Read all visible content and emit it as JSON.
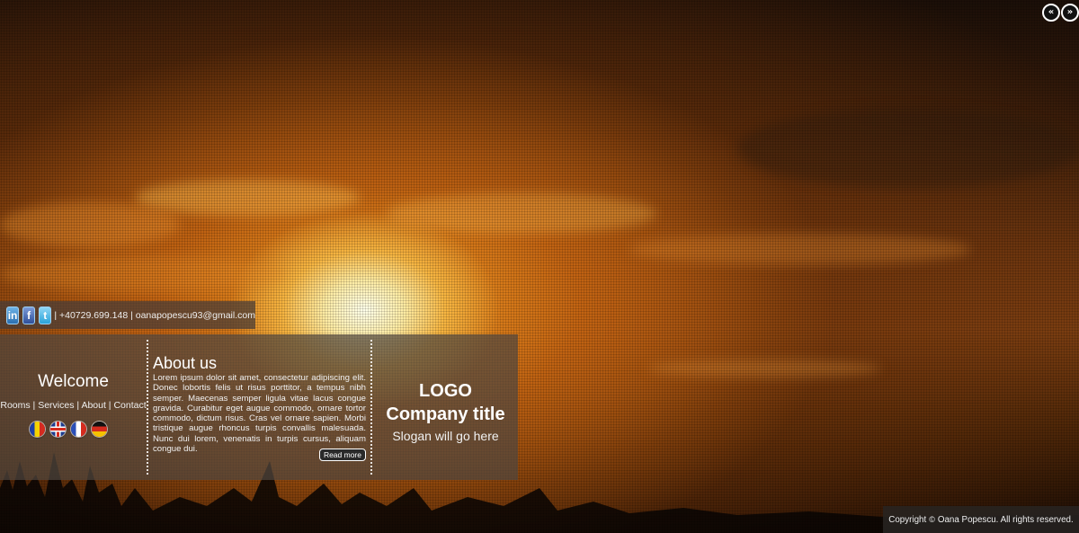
{
  "nav": {
    "prev_icon": "double-chevron-left-icon",
    "prev_glyph": "«",
    "next_icon": "double-chevron-right-icon",
    "next_glyph": "»"
  },
  "contact": {
    "social": [
      {
        "name": "linkedin-icon",
        "glyph": "in"
      },
      {
        "name": "facebook-icon",
        "glyph": "f"
      },
      {
        "name": "twitter-icon",
        "glyph": "t"
      }
    ],
    "text": "| +40729.699.148 | oanapopescu93@gmail.com"
  },
  "welcome": {
    "title": "Welcome",
    "links": [
      "Rooms",
      "Services",
      "About",
      "Contact"
    ],
    "separator": " | ",
    "flags": [
      "romanian-flag-icon",
      "uk-flag-icon",
      "french-flag-icon",
      "german-flag-icon"
    ]
  },
  "about": {
    "title": "About us",
    "text": "Lorem ipsum dolor sit amet, consectetur adipiscing elit. Donec lobortis felis ut risus porttitor, a tempus nibh semper. Maecenas semper ligula vitae lacus congue gravida. Curabitur eget augue commodo, ornare tortor commodo, dictum risus. Cras vel ornare sapien. Morbi tristique augue rhoncus turpis convallis malesuada. Nunc dui lorem, venenatis in turpis cursus, aliquam congue dui.",
    "read_more": "Read more"
  },
  "brand": {
    "logo": "LOGO",
    "company_title": "Company title",
    "slogan": "Slogan will go here"
  },
  "footer": {
    "prefix": "Copyright",
    "symbol": "©",
    "text": "Oana Popescu. All rights reserved."
  },
  "colors": {
    "panel_bg": "#50463e",
    "accent_sun": "#ffd27a"
  }
}
